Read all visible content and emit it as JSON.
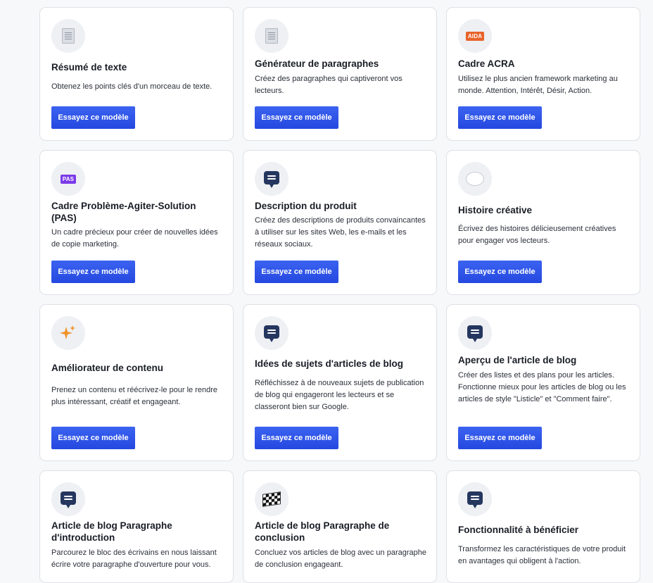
{
  "button_label": "Essayez ce modèle",
  "colors": {
    "button": "#2a4fe6",
    "badge_aida": "#e8632a",
    "badge_pas": "#7b3ae8",
    "sparkle": "#f0932b",
    "chat": "#25365f"
  },
  "cards": [
    {
      "title": "Résumé de texte",
      "description": "Obtenez les points clés d'un morceau de texte.",
      "icon": "document-icon"
    },
    {
      "title": "Générateur de paragraphes",
      "description": "Créez des paragraphes qui captiveront vos lecteurs.",
      "icon": "document-icon"
    },
    {
      "title": "Cadre ACRA",
      "description": "Utilisez le plus ancien framework marketing au monde. Attention, Intérêt, Désir, Action.",
      "icon": "aida-badge-icon",
      "badge": "AIDA"
    },
    {
      "title": "Cadre Problème-Agiter-Solution (PAS)",
      "description": "Un cadre précieux pour créer de nouvelles idées de copie marketing.",
      "icon": "pas-badge-icon",
      "badge": "PAS"
    },
    {
      "title": "Description du produit",
      "description": "Créez des descriptions de produits convaincantes à utiliser sur les sites Web, les e-mails et les réseaux sociaux.",
      "icon": "chat-icon"
    },
    {
      "title": "Histoire créative",
      "description": "Écrivez des histoires délicieusement créatives pour engager vos lecteurs.",
      "icon": "thought-bubble-icon"
    },
    {
      "title": "Améliorateur de contenu",
      "description": "Prenez un contenu et réécrivez-le pour le rendre plus intéressant, créatif et engageant.",
      "icon": "sparkles-icon"
    },
    {
      "title": "Idées de sujets d'articles de blog",
      "description": "Réfléchissez à de nouveaux sujets de publication de blog qui engageront les lecteurs et se classeront bien sur Google.",
      "icon": "chat-icon"
    },
    {
      "title": "Aperçu de l'article de blog",
      "description": "Créer des listes et des plans pour les articles. Fonctionne mieux pour les articles de blog ou les articles de style \"Listicle\" et \"Comment faire\".",
      "icon": "chat-icon"
    },
    {
      "title": "Article de blog Paragraphe d'introduction",
      "description": "Parcourez le bloc des écrivains en nous laissant écrire votre paragraphe d'ouverture pour vous.",
      "icon": "chat-icon"
    },
    {
      "title": "Article de blog Paragraphe de conclusion",
      "description": "Concluez vos articles de blog avec un paragraphe de conclusion engageant.",
      "icon": "checkered-flag-icon"
    },
    {
      "title": "Fonctionnalité à bénéficier",
      "description": "Transformez les caractéristiques de votre produit en avantages qui obligent à l'action.",
      "icon": "chat-icon"
    }
  ]
}
